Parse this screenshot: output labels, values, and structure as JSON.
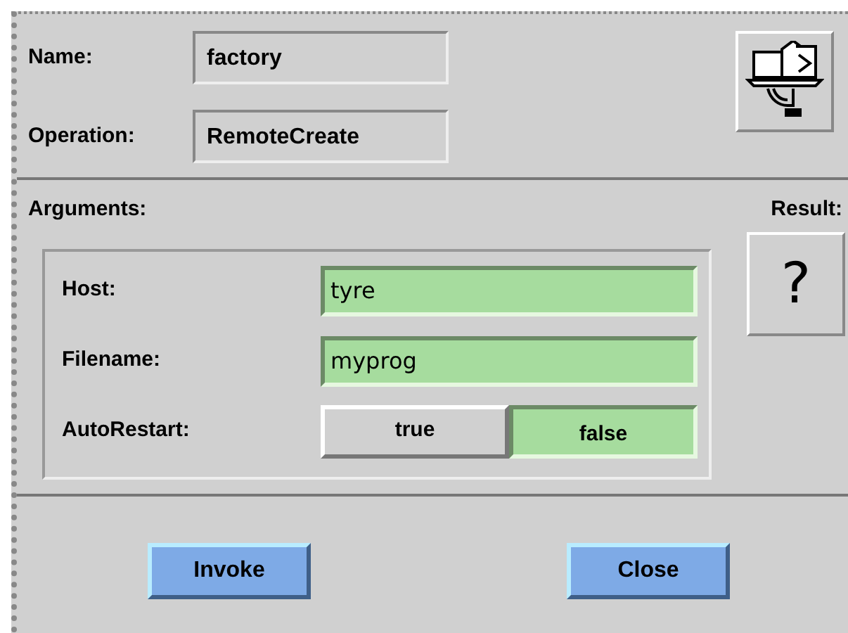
{
  "header": {
    "fields": [
      {
        "label": "Name:",
        "value": "factory"
      },
      {
        "label": "Operation:",
        "value": "RemoteCreate"
      }
    ]
  },
  "arguments": {
    "label": "Arguments:",
    "items": [
      {
        "kind": "text",
        "label": "Host:",
        "value": "tyre"
      },
      {
        "kind": "text",
        "label": "Filename:",
        "value": "myprog"
      },
      {
        "kind": "toggle",
        "label": "AutoRestart:",
        "options": [
          {
            "label": "true",
            "selected": false
          },
          {
            "label": "false",
            "selected": true
          }
        ]
      }
    ]
  },
  "result": {
    "label": "Result:",
    "value": "?"
  },
  "buttons": [
    "Invoke",
    "Close"
  ]
}
